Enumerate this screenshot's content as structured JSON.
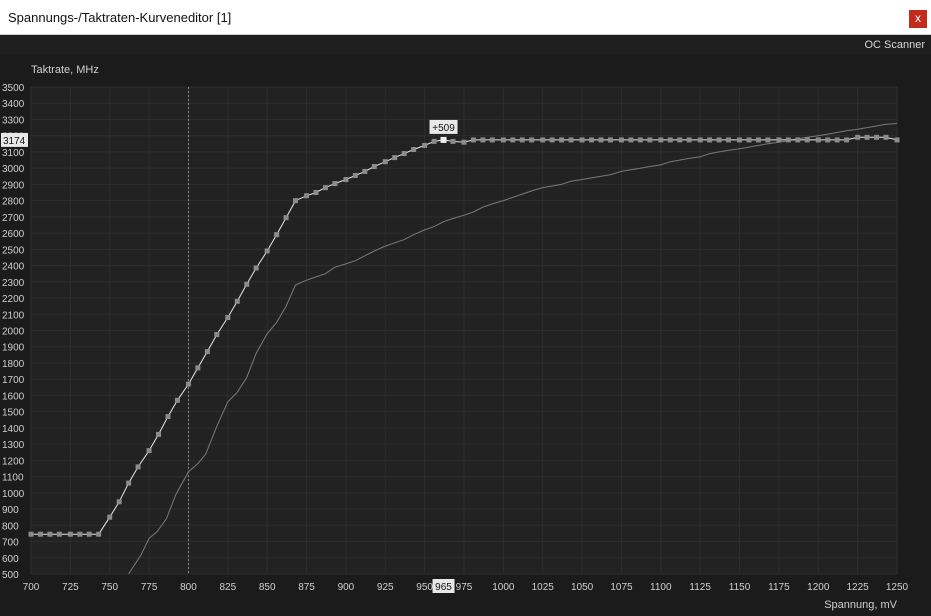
{
  "window": {
    "title": "Spannungs-/Taktraten-Kurveneditor [1]",
    "close_label": "x"
  },
  "menu": {
    "oc_scanner": "OC Scanner"
  },
  "chart_data": {
    "type": "line",
    "ylabel": "Taktrate, MHz",
    "xlabel": "Spannung, mV",
    "xlim": [
      700,
      1250
    ],
    "ylim": [
      500,
      3500
    ],
    "x_ticks": [
      700,
      725,
      750,
      775,
      800,
      825,
      850,
      875,
      900,
      925,
      950,
      975,
      1000,
      1025,
      1050,
      1075,
      1100,
      1125,
      1150,
      1175,
      1200,
      1225,
      1250
    ],
    "y_ticks": [
      500,
      600,
      700,
      800,
      900,
      1000,
      1100,
      1200,
      1300,
      1400,
      1500,
      1600,
      1700,
      1800,
      1900,
      2000,
      2100,
      2200,
      2300,
      2400,
      2500,
      2600,
      2700,
      2800,
      2900,
      3000,
      3100,
      3200,
      3300,
      3400,
      3500
    ],
    "grid": true,
    "vertical_marker_x": 800,
    "selected_point": {
      "voltage": "965",
      "frequency": "3174",
      "offset": "+509"
    },
    "series": [
      {
        "style": "edited-curve-white",
        "points": [
          [
            700,
            745
          ],
          [
            706,
            745
          ],
          [
            712,
            745
          ],
          [
            718,
            745
          ],
          [
            725,
            745
          ],
          [
            731,
            745
          ],
          [
            737,
            745
          ],
          [
            743,
            745
          ],
          [
            750,
            850
          ],
          [
            756,
            945
          ],
          [
            762,
            1060
          ],
          [
            768,
            1160
          ],
          [
            775,
            1260
          ],
          [
            781,
            1360
          ],
          [
            787,
            1470
          ],
          [
            793,
            1570
          ],
          [
            800,
            1670
          ],
          [
            806,
            1770
          ],
          [
            812,
            1870
          ],
          [
            818,
            1975
          ],
          [
            825,
            2080
          ],
          [
            831,
            2180
          ],
          [
            837,
            2285
          ],
          [
            843,
            2385
          ],
          [
            850,
            2490
          ],
          [
            856,
            2590
          ],
          [
            862,
            2695
          ],
          [
            868,
            2800
          ],
          [
            875,
            2830
          ],
          [
            881,
            2850
          ],
          [
            887,
            2880
          ],
          [
            893,
            2905
          ],
          [
            900,
            2930
          ],
          [
            906,
            2955
          ],
          [
            912,
            2980
          ],
          [
            918,
            3010
          ],
          [
            925,
            3040
          ],
          [
            931,
            3065
          ],
          [
            937,
            3090
          ],
          [
            943,
            3115
          ],
          [
            950,
            3140
          ],
          [
            956,
            3165
          ],
          [
            962,
            3174
          ],
          [
            968,
            3165
          ],
          [
            975,
            3160
          ],
          [
            981,
            3174
          ],
          [
            987,
            3174
          ],
          [
            993,
            3174
          ],
          [
            1000,
            3174
          ],
          [
            1006,
            3174
          ],
          [
            1012,
            3174
          ],
          [
            1018,
            3174
          ],
          [
            1025,
            3174
          ],
          [
            1031,
            3174
          ],
          [
            1037,
            3174
          ],
          [
            1043,
            3174
          ],
          [
            1050,
            3174
          ],
          [
            1056,
            3174
          ],
          [
            1062,
            3174
          ],
          [
            1068,
            3174
          ],
          [
            1075,
            3174
          ],
          [
            1081,
            3174
          ],
          [
            1087,
            3174
          ],
          [
            1093,
            3174
          ],
          [
            1100,
            3174
          ],
          [
            1106,
            3174
          ],
          [
            1112,
            3174
          ],
          [
            1118,
            3174
          ],
          [
            1125,
            3174
          ],
          [
            1131,
            3174
          ],
          [
            1137,
            3174
          ],
          [
            1143,
            3174
          ],
          [
            1150,
            3174
          ],
          [
            1156,
            3174
          ],
          [
            1162,
            3174
          ],
          [
            1168,
            3174
          ],
          [
            1175,
            3174
          ],
          [
            1181,
            3174
          ],
          [
            1187,
            3174
          ],
          [
            1193,
            3174
          ],
          [
            1200,
            3174
          ],
          [
            1206,
            3174
          ],
          [
            1212,
            3174
          ],
          [
            1218,
            3174
          ],
          [
            1225,
            3190
          ],
          [
            1231,
            3190
          ],
          [
            1237,
            3190
          ],
          [
            1243,
            3190
          ],
          [
            1250,
            3174
          ]
        ]
      },
      {
        "style": "default-curve-grey",
        "points": [
          [
            762,
            500
          ],
          [
            770,
            620
          ],
          [
            775,
            720
          ],
          [
            780,
            760
          ],
          [
            786,
            840
          ],
          [
            792,
            990
          ],
          [
            800,
            1130
          ],
          [
            806,
            1180
          ],
          [
            811,
            1240
          ],
          [
            818,
            1410
          ],
          [
            825,
            1560
          ],
          [
            831,
            1620
          ],
          [
            837,
            1710
          ],
          [
            843,
            1860
          ],
          [
            850,
            1980
          ],
          [
            856,
            2050
          ],
          [
            862,
            2150
          ],
          [
            868,
            2280
          ],
          [
            875,
            2310
          ],
          [
            881,
            2330
          ],
          [
            887,
            2350
          ],
          [
            893,
            2390
          ],
          [
            900,
            2410
          ],
          [
            906,
            2430
          ],
          [
            912,
            2460
          ],
          [
            918,
            2490
          ],
          [
            925,
            2520
          ],
          [
            931,
            2540
          ],
          [
            937,
            2560
          ],
          [
            943,
            2590
          ],
          [
            950,
            2620
          ],
          [
            956,
            2640
          ],
          [
            962,
            2670
          ],
          [
            968,
            2690
          ],
          [
            975,
            2710
          ],
          [
            981,
            2730
          ],
          [
            987,
            2760
          ],
          [
            993,
            2780
          ],
          [
            1000,
            2800
          ],
          [
            1006,
            2820
          ],
          [
            1012,
            2840
          ],
          [
            1018,
            2860
          ],
          [
            1025,
            2880
          ],
          [
            1031,
            2890
          ],
          [
            1037,
            2900
          ],
          [
            1043,
            2920
          ],
          [
            1050,
            2930
          ],
          [
            1056,
            2940
          ],
          [
            1062,
            2950
          ],
          [
            1068,
            2960
          ],
          [
            1075,
            2980
          ],
          [
            1081,
            2990
          ],
          [
            1087,
            3000
          ],
          [
            1093,
            3010
          ],
          [
            1100,
            3020
          ],
          [
            1106,
            3040
          ],
          [
            1112,
            3050
          ],
          [
            1118,
            3060
          ],
          [
            1125,
            3070
          ],
          [
            1131,
            3090
          ],
          [
            1137,
            3100
          ],
          [
            1143,
            3110
          ],
          [
            1150,
            3120
          ],
          [
            1156,
            3130
          ],
          [
            1162,
            3140
          ],
          [
            1168,
            3150
          ],
          [
            1175,
            3160
          ],
          [
            1181,
            3170
          ],
          [
            1187,
            3180
          ],
          [
            1193,
            3190
          ],
          [
            1200,
            3200
          ],
          [
            1206,
            3210
          ],
          [
            1212,
            3220
          ],
          [
            1218,
            3230
          ],
          [
            1225,
            3240
          ],
          [
            1231,
            3250
          ],
          [
            1237,
            3260
          ],
          [
            1243,
            3270
          ],
          [
            1250,
            3275
          ]
        ]
      }
    ]
  }
}
